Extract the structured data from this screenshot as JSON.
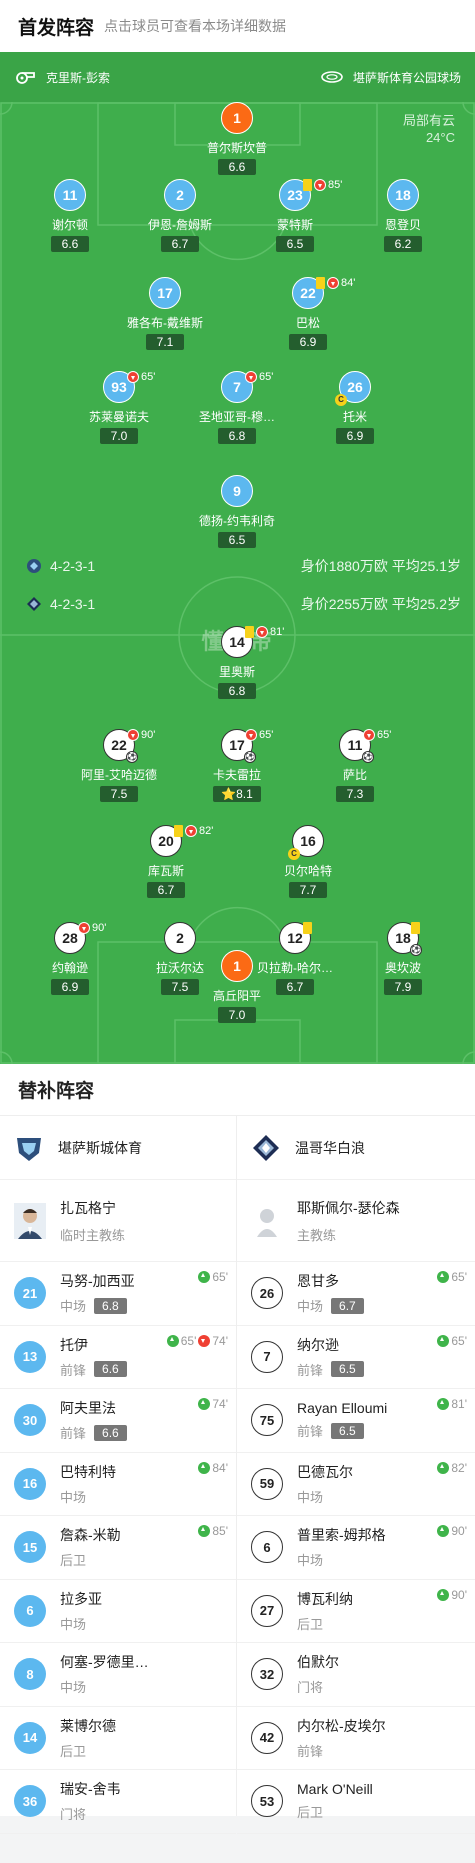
{
  "header": {
    "title": "首发阵容",
    "hint": "点击球员可查看本场详细数据"
  },
  "info": {
    "referee": "克里斯-彭索",
    "stadium": "堪萨斯体育公园球场",
    "weather": "局部有云",
    "temp": "24°C"
  },
  "home_lineup": {
    "formation": "4-2-3-1",
    "summary": "身价1880万欧 平均25.1岁",
    "players": [
      {
        "num": "1",
        "name": "普尔斯坎普",
        "rating": "6.6",
        "gk": true
      },
      {
        "num": "11",
        "name": "谢尔顿",
        "rating": "6.6"
      },
      {
        "num": "2",
        "name": "伊恩-詹姆斯",
        "rating": "6.7"
      },
      {
        "num": "23",
        "name": "蒙特斯",
        "rating": "6.5",
        "yellow": true,
        "subout": true,
        "time": "85'"
      },
      {
        "num": "18",
        "name": "恩登贝",
        "rating": "6.2"
      },
      {
        "num": "17",
        "name": "雅各布-戴维斯",
        "rating": "7.1"
      },
      {
        "num": "22",
        "name": "巴松",
        "rating": "6.9",
        "yellow": true,
        "subout": true,
        "time": "84'"
      },
      {
        "num": "93",
        "name": "苏莱曼诺夫",
        "rating": "7.0",
        "subout": true,
        "time": "65'"
      },
      {
        "num": "7",
        "name": "圣地亚哥-穆…",
        "rating": "6.8",
        "subout": true,
        "time": "65'"
      },
      {
        "num": "26",
        "name": "托米",
        "rating": "6.9",
        "captain": true
      },
      {
        "num": "9",
        "name": "德扬-约韦利奇",
        "rating": "6.5"
      }
    ]
  },
  "watermark": "懂球帝",
  "away_lineup": {
    "formation": "4-2-3-1",
    "summary": "身价2255万欧 平均25.2岁",
    "players": [
      {
        "num": "14",
        "name": "里奥斯",
        "rating": "6.8",
        "yellow": true,
        "subout": true,
        "time": "81'"
      },
      {
        "num": "22",
        "name": "阿里-艾哈迈德",
        "rating": "7.5",
        "subout": true,
        "time": "90'",
        "goal": true
      },
      {
        "num": "17",
        "name": "卡夫雷拉",
        "rating": "8.1",
        "subout": true,
        "time": "65'",
        "goal": true,
        "star": true
      },
      {
        "num": "11",
        "name": "萨比",
        "rating": "7.3",
        "subout": true,
        "time": "65'",
        "goal": true
      },
      {
        "num": "20",
        "name": "库瓦斯",
        "rating": "6.7",
        "yellow": true,
        "subout": true,
        "time": "82'"
      },
      {
        "num": "16",
        "name": "贝尔哈特",
        "rating": "7.7",
        "captain": true
      },
      {
        "num": "28",
        "name": "约翰逊",
        "rating": "6.9",
        "subout": true,
        "time": "90'"
      },
      {
        "num": "2",
        "name": "拉沃尔达",
        "rating": "7.5"
      },
      {
        "num": "12",
        "name": "贝拉勒-哈尔…",
        "rating": "6.7",
        "yellow": true
      },
      {
        "num": "18",
        "name": "奥坎波",
        "rating": "7.9",
        "yellow": true,
        "goal": true
      },
      {
        "num": "1",
        "name": "高丘阳平",
        "rating": "7.0",
        "gk": true
      }
    ]
  },
  "subs": {
    "title": "替补阵容",
    "home": {
      "team": "堪萨斯城体育",
      "coach": {
        "name": "扎瓦格宁",
        "role": "临时主教练"
      },
      "players": [
        {
          "num": "21",
          "name": "马努-加西亚",
          "pos": "中场",
          "rating": "6.8",
          "ev": "65'"
        },
        {
          "num": "13",
          "name": "托伊",
          "pos": "前锋",
          "rating": "6.6",
          "ev": "65'",
          "ev2": "74'"
        },
        {
          "num": "30",
          "name": "阿夫里法",
          "pos": "前锋",
          "rating": "6.6",
          "ev": "74'"
        },
        {
          "num": "16",
          "name": "巴特利特",
          "pos": "中场",
          "ev": "84'"
        },
        {
          "num": "15",
          "name": "詹森-米勒",
          "pos": "后卫",
          "ev": "85'"
        },
        {
          "num": "6",
          "name": "拉多亚",
          "pos": "中场"
        },
        {
          "num": "8",
          "name": "何塞-罗德里…",
          "pos": "中场"
        },
        {
          "num": "14",
          "name": "莱博尔德",
          "pos": "后卫"
        },
        {
          "num": "36",
          "name": "瑞安-舍韦",
          "pos": "门将"
        }
      ]
    },
    "away": {
      "team": "温哥华白浪",
      "coach": {
        "name": "耶斯佩尔-瑟伦森",
        "role": "主教练"
      },
      "players": [
        {
          "num": "26",
          "name": "恩甘多",
          "pos": "中场",
          "rating": "6.7",
          "ev": "65'"
        },
        {
          "num": "7",
          "name": "纳尔逊",
          "pos": "前锋",
          "rating": "6.5",
          "ev": "65'"
        },
        {
          "num": "75",
          "name": "Rayan Elloumi",
          "pos": "前锋",
          "rating": "6.5",
          "ev": "81'"
        },
        {
          "num": "59",
          "name": "巴德瓦尔",
          "pos": "中场",
          "ev": "82'"
        },
        {
          "num": "6",
          "name": "普里索-姆邦格",
          "pos": "中场",
          "ev": "90'"
        },
        {
          "num": "27",
          "name": "博瓦利纳",
          "pos": "后卫",
          "ev": "90'"
        },
        {
          "num": "32",
          "name": "伯默尔",
          "pos": "门将"
        },
        {
          "num": "42",
          "name": "内尔松-皮埃尔",
          "pos": "前锋"
        },
        {
          "num": "53",
          "name": "Mark O'Neill",
          "pos": "后卫"
        }
      ]
    }
  },
  "colors": {
    "pitch": "#3fae4c",
    "home_kit": "#5cb8ef",
    "away_kit": "#ffffff",
    "gk": "#fb6a15"
  }
}
